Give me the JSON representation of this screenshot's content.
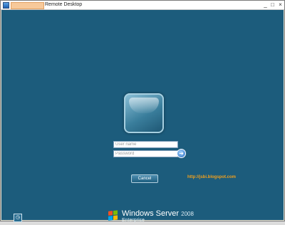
{
  "window": {
    "title": "Remote Desktop",
    "controls": {
      "minimize": "_",
      "maximize": "□",
      "close": "×"
    }
  },
  "logon": {
    "username_placeholder": "User name",
    "password_placeholder": "Password",
    "go_symbol": "➜",
    "cancel_label": "Cancel"
  },
  "watermark": {
    "link_text": "http://jsbi.blogspot.com",
    "color": "#f0a01e"
  },
  "accessibility": {
    "icon": "ease-of-access-icon",
    "symbol": "◷"
  },
  "brand": {
    "name": "Windows Server",
    "version": "2008",
    "edition": "Enterprise"
  },
  "colors": {
    "background": "#1c5c7c",
    "title_bar": "#ffffff"
  }
}
